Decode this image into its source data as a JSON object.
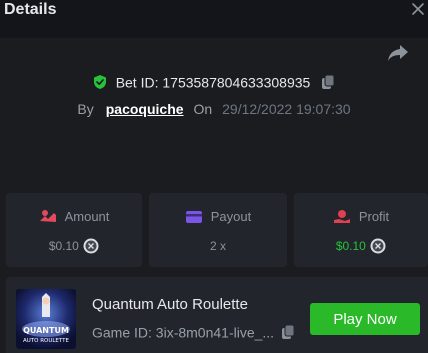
{
  "header": {
    "title": "Details"
  },
  "bet": {
    "id_label": "Bet ID: 1753587804633308935",
    "by_label": "By",
    "username": "pacoquiche",
    "on_label": "On",
    "datetime": "29/12/2022 19:07:30"
  },
  "stats": {
    "amount": {
      "label": "Amount",
      "value": "$0.10"
    },
    "payout": {
      "label": "Payout",
      "value": "2 x"
    },
    "profit": {
      "label": "Profit",
      "value": "$0.10"
    }
  },
  "game": {
    "name": "Quantum Auto Roulette",
    "id_label": "Game ID: 3ix-8m0n41-live_...",
    "play_label": "Play Now",
    "thumb_text_1": "QUANTUM",
    "thumb_text_2": "AUTO ROULETTE"
  },
  "colors": {
    "accent_green": "#29b929",
    "profit_green": "#27c23a",
    "amount_icon": "#e24b5e",
    "payout_icon": "#7b55e6",
    "profit_icon": "#e0404f"
  },
  "icons": [
    "close-icon",
    "share-icon",
    "shield-check-icon",
    "copy-icon",
    "coins-icon",
    "card-icon",
    "profit-icon",
    "currency-coin-icon"
  ]
}
